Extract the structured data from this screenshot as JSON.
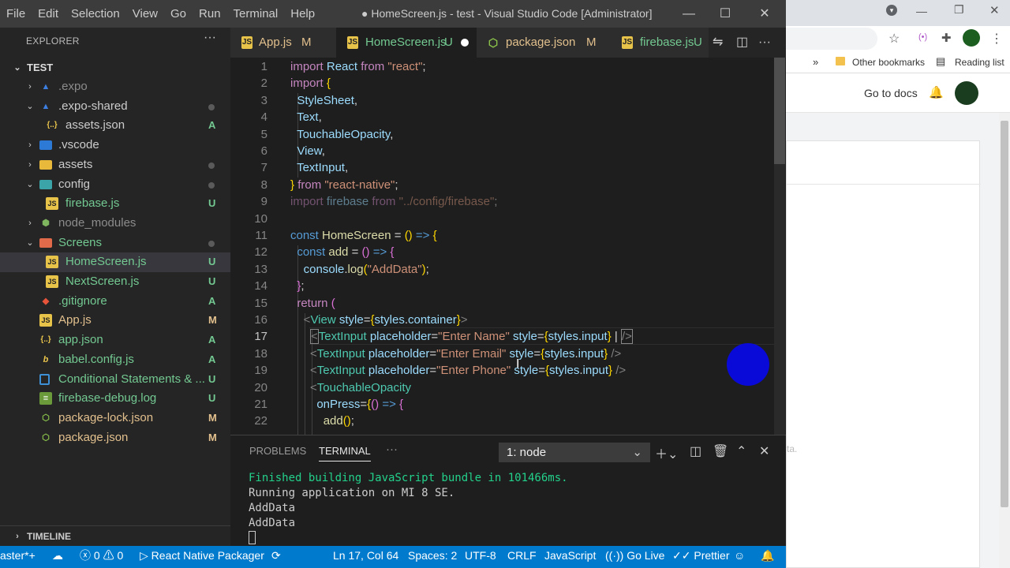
{
  "menu": [
    "File",
    "Edit",
    "Selection",
    "View",
    "Go",
    "Run",
    "Terminal",
    "Help"
  ],
  "window_title": "● HomeScreen.js - test - Visual Studio Code [Administrator]",
  "window_controls": {
    "minimize": "—",
    "maximize": "☐",
    "close": "✕"
  },
  "explorer": {
    "title": "EXPLORER",
    "more": "···",
    "root": "TEST",
    "items": [
      {
        "label": ".expo",
        "status": "",
        "dot": false
      },
      {
        "label": ".expo-shared",
        "status": "",
        "dot": true
      },
      {
        "label": "assets.json",
        "status": "A",
        "dot": false
      },
      {
        "label": ".vscode",
        "status": "",
        "dot": false
      },
      {
        "label": "assets",
        "status": "",
        "dot": true
      },
      {
        "label": "config",
        "status": "",
        "dot": true
      },
      {
        "label": "firebase.js",
        "status": "U",
        "dot": false
      },
      {
        "label": "node_modules",
        "status": "",
        "dot": false
      },
      {
        "label": "Screens",
        "status": "",
        "dot": true
      },
      {
        "label": "HomeScreen.js",
        "status": "U",
        "dot": false
      },
      {
        "label": "NextScreen.js",
        "status": "U",
        "dot": false
      },
      {
        "label": ".gitignore",
        "status": "A",
        "dot": false
      },
      {
        "label": "App.js",
        "status": "M",
        "dot": false
      },
      {
        "label": "app.json",
        "status": "A",
        "dot": false
      },
      {
        "label": "babel.config.js",
        "status": "A",
        "dot": false
      },
      {
        "label": "Conditional Statements & ...",
        "status": "U",
        "dot": false
      },
      {
        "label": "firebase-debug.log",
        "status": "U",
        "dot": false
      },
      {
        "label": "package-lock.json",
        "status": "M",
        "dot": false
      },
      {
        "label": "package.json",
        "status": "M",
        "dot": false
      }
    ],
    "timeline": "TIMELINE"
  },
  "tabs": [
    {
      "label": "App.js",
      "status": "M"
    },
    {
      "label": "HomeScreen.js",
      "status": "U"
    },
    {
      "label": "package.json",
      "status": "M"
    },
    {
      "label": "firebase.js",
      "status": "U"
    }
  ],
  "editor": {
    "line_numbers": [
      "1",
      "2",
      "3",
      "4",
      "5",
      "6",
      "7",
      "8",
      "9",
      "10",
      "11",
      "12",
      "13",
      "14",
      "15",
      "16",
      "17",
      "18",
      "19",
      "20",
      "21",
      "22"
    ],
    "current_line": "17"
  },
  "panel": {
    "tabs": [
      "PROBLEMS",
      "TERMINAL"
    ],
    "more": "···",
    "terminal_select": "1: node",
    "terminal_lines": [
      "Finished building JavaScript bundle in 101466ms.",
      "Running application on MI 8 SE.",
      "AddData",
      "AddData"
    ]
  },
  "status_bar": {
    "branch": "aster*+",
    "errors": "0",
    "warnings": "0",
    "packager": "React Native Packager",
    "position": "Ln 17, Col 64",
    "spaces": "Spaces: 2",
    "encoding": "UTF-8",
    "eol": "CRLF",
    "language": "JavaScript",
    "golive": "Go Live",
    "prettier": "Prettier"
  },
  "chrome": {
    "bookmarks_more": "»",
    "other_bookmarks": "Other bookmarks",
    "reading_list": "Reading list",
    "go_to_docs": "Go to docs",
    "faint_text": "ta."
  },
  "colors": {
    "accent": "#007acc",
    "editor_bg": "#1e1e1e",
    "sidebar_bg": "#252526"
  }
}
